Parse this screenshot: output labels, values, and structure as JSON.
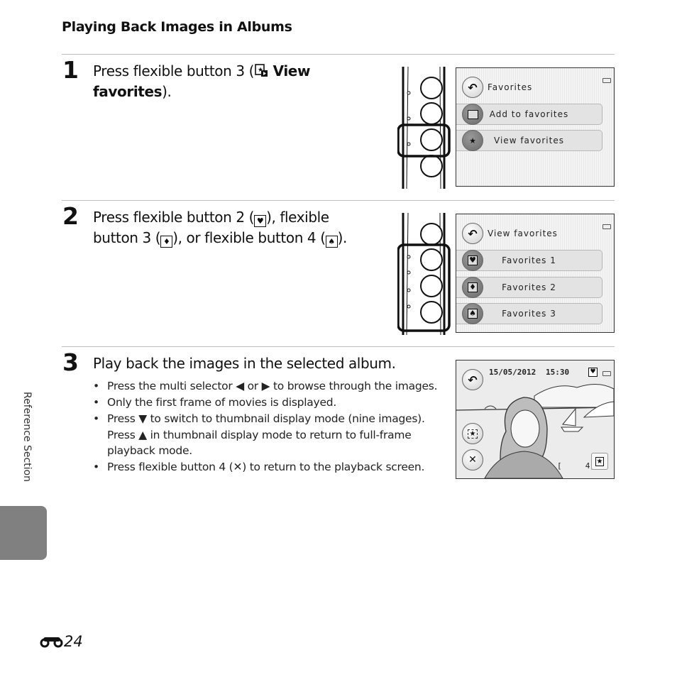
{
  "section_title": "Playing Back Images in Albums",
  "steps": [
    {
      "number": "1",
      "text_prefix": "Press flexible button 3 (",
      "icon": "view-favorites-icon",
      "text_bold": " View favorites",
      "text_suffix": ")."
    },
    {
      "number": "2",
      "line1_prefix": "Press flexible button 2 (",
      "icon1": "favorites-heart-icon",
      "line1_mid": "), flexible",
      "line2_prefix": "button 3 (",
      "icon2": "favorites-diamond-icon",
      "line2_mid": "), or flexible button 4 (",
      "icon3": "favorites-spade-icon",
      "line2_suffix": ")."
    },
    {
      "number": "3",
      "text": "Play back the images in the selected album.",
      "bullets": [
        {
          "pre": "Press the multi selector ",
          "g1": "◀",
          "mid": " or ",
          "g2": "▶",
          "post": " to browse through the images."
        },
        {
          "pre": "Only the first frame of movies is displayed.",
          "g1": "",
          "mid": "",
          "g2": "",
          "post": ""
        },
        {
          "pre": "Press ",
          "g1": "▼",
          "mid": " to switch to thumbnail display mode (nine images). Press ",
          "g2": "▲",
          "post": " in thumbnail display mode to return to full-frame playback mode."
        },
        {
          "pre": "Press flexible button 4 (",
          "g1": "✕",
          "mid": ") to return to the playback screen.",
          "g2": "",
          "post": ""
        }
      ]
    }
  ],
  "screen1": {
    "header": "Favorites",
    "items": [
      "Add to favorites",
      "View favorites"
    ]
  },
  "screen2": {
    "header": "View favorites",
    "items": [
      "Favorites 1",
      "Favorites 2",
      "Favorites 3"
    ]
  },
  "screen3": {
    "date": "15/05/2012",
    "time": "15:30",
    "frame_counter": "[     4]"
  },
  "side_label": "Reference Section",
  "page_number": "24",
  "colors": {
    "side_tab": "#808080",
    "rule": "#bdbdbd"
  }
}
